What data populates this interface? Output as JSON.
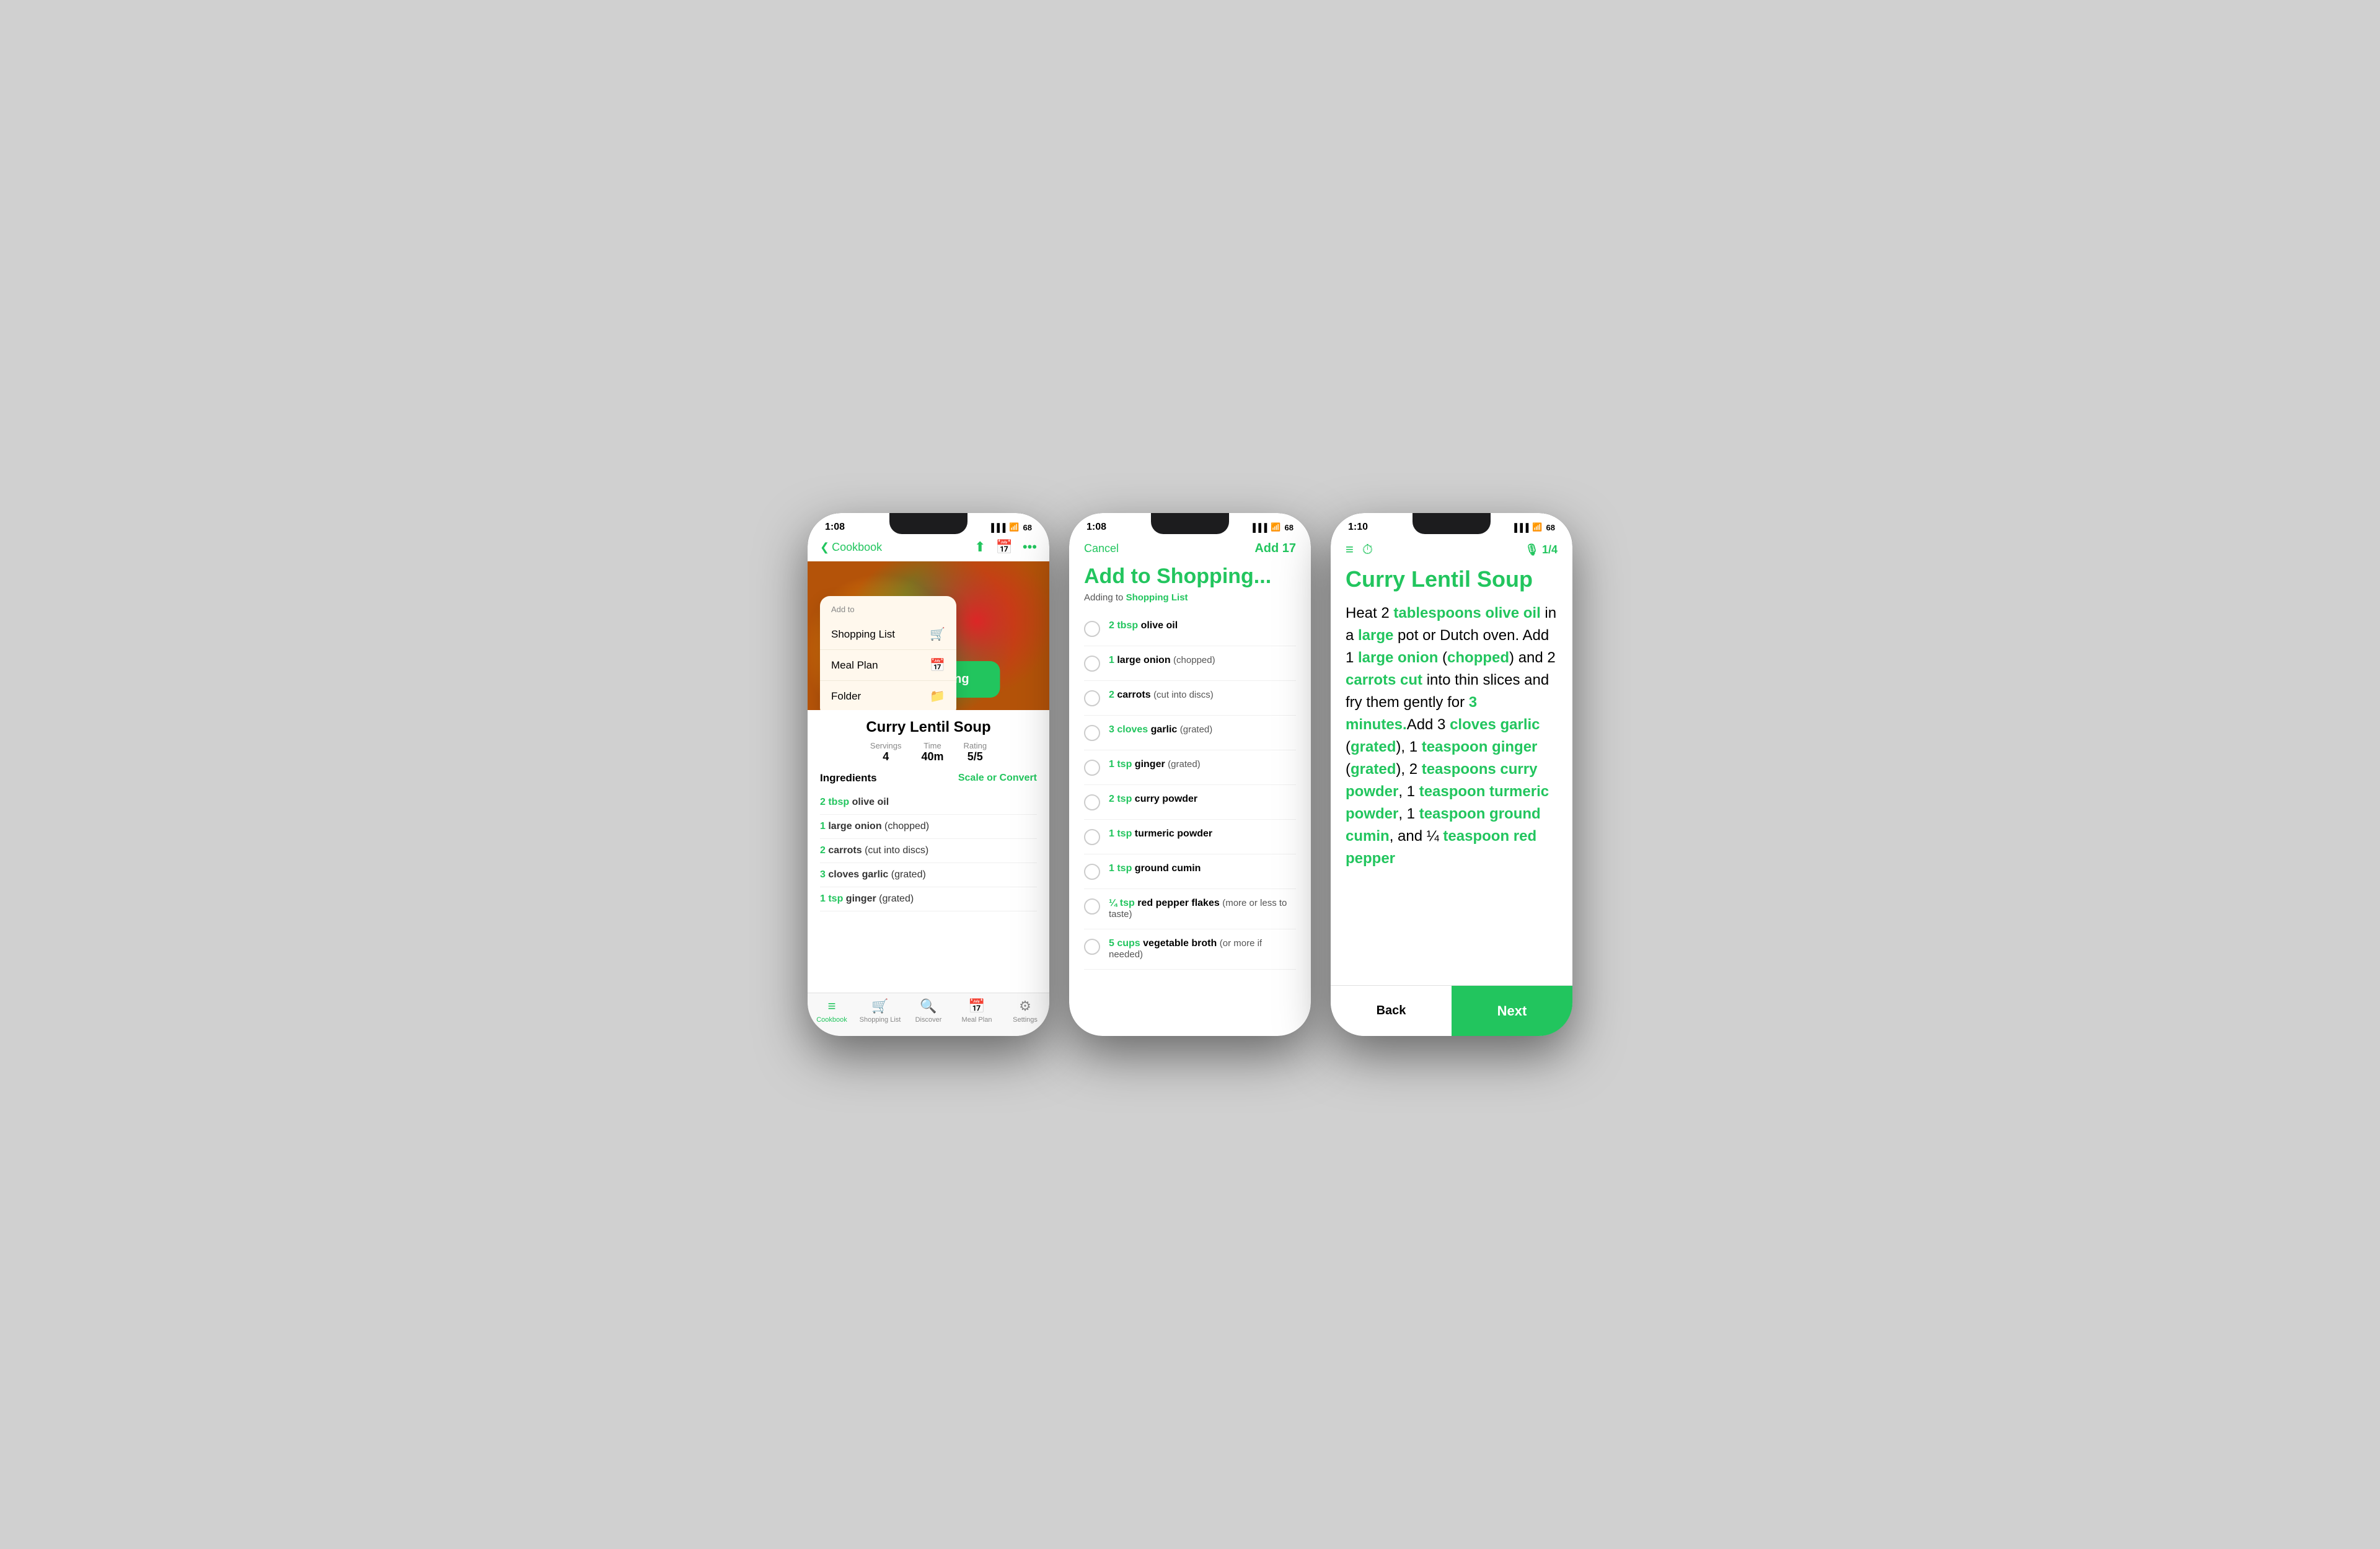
{
  "colors": {
    "green": "#22c55e",
    "white": "#ffffff",
    "black": "#000000",
    "gray": "#888888",
    "light_gray": "#f0f0f0",
    "dropdown_bg": "#fff8ed"
  },
  "phone1": {
    "status_time": "1:08",
    "nav_back_label": "Cookbook",
    "dropdown": {
      "label": "Add to",
      "items": [
        {
          "label": "Shopping List",
          "icon": "🛒"
        },
        {
          "label": "Meal Plan",
          "icon": "📅"
        },
        {
          "label": "Folder",
          "icon": "📁"
        }
      ]
    },
    "start_cooking_label": "Start Cooking",
    "recipe_title": "Curry Lentil Soup",
    "servings_label": "Servings",
    "servings_value": "4",
    "time_label": "Time",
    "time_value": "40m",
    "rating_label": "Rating",
    "rating_value": "5/5",
    "ingredients_title": "Ingredients",
    "scale_label": "Scale or Convert",
    "ingredients": [
      {
        "amount": "2 tbsp",
        "name": "olive oil",
        "note": ""
      },
      {
        "amount": "1",
        "name": "large onion",
        "note": "(chopped)"
      },
      {
        "amount": "2",
        "name": "carrots",
        "note": "(cut into discs)"
      },
      {
        "amount": "3 cloves",
        "name": "garlic",
        "note": "(grated)"
      },
      {
        "amount": "1 tsp",
        "name": "ginger",
        "note": "(grated)"
      }
    ],
    "tabs": [
      {
        "label": "Cookbook",
        "icon": "≡",
        "active": true
      },
      {
        "label": "Shopping List",
        "icon": "🛒",
        "active": false
      },
      {
        "label": "Discover",
        "icon": "🔍",
        "active": false
      },
      {
        "label": "Meal Plan",
        "icon": "📅",
        "active": false
      },
      {
        "label": "Settings",
        "icon": "⚙",
        "active": false
      }
    ]
  },
  "phone2": {
    "status_time": "1:08",
    "cancel_label": "Cancel",
    "add_label": "Add 17",
    "title": "Add to Shopping...",
    "subtitle": "Adding to",
    "subtitle_list": "Shopping List",
    "items": [
      {
        "amount": "2 tbsp",
        "name": "olive oil",
        "note": ""
      },
      {
        "amount": "1",
        "name": "large onion",
        "note": "(chopped)"
      },
      {
        "amount": "2",
        "name": "carrots",
        "note": "(cut into discs)"
      },
      {
        "amount": "3 cloves",
        "name": "garlic",
        "note": "(grated)"
      },
      {
        "amount": "1 tsp",
        "name": "ginger",
        "note": "(grated)"
      },
      {
        "amount": "2 tsp",
        "name": "curry powder",
        "note": ""
      },
      {
        "amount": "1 tsp",
        "name": "turmeric powder",
        "note": ""
      },
      {
        "amount": "1 tsp",
        "name": "ground cumin",
        "note": ""
      },
      {
        "amount": "¼ tsp",
        "name": "red pepper flakes",
        "note": "(more or less to taste)"
      },
      {
        "amount": "5 cups",
        "name": "vegetable broth",
        "note": "(or more if needed)"
      }
    ]
  },
  "phone3": {
    "status_time": "1:10",
    "step_indicator": "1/4",
    "recipe_title": "Curry Lentil Soup",
    "cook_text_parts": [
      {
        "text": "Heat 2 ",
        "highlight": false
      },
      {
        "text": "tablespoons olive oil",
        "highlight": true
      },
      {
        "text": " in a ",
        "highlight": false
      },
      {
        "text": "large",
        "highlight": true
      },
      {
        "text": " pot or Dutch oven. Add 1 ",
        "highlight": false
      },
      {
        "text": "large onion",
        "highlight": true
      },
      {
        "text": " (",
        "highlight": false
      },
      {
        "text": "chopped",
        "highlight": true
      },
      {
        "text": ") and 2 ",
        "highlight": false
      },
      {
        "text": "carrots cut",
        "highlight": true
      },
      {
        "text": " into thin slices and fry them gently for ",
        "highlight": false
      },
      {
        "text": "3 minutes.",
        "highlight": true
      },
      {
        "text": "Add 3 ",
        "highlight": false
      },
      {
        "text": "cloves garlic",
        "highlight": true
      },
      {
        "text": " (",
        "highlight": false
      },
      {
        "text": "grated",
        "highlight": true
      },
      {
        "text": "), 1 ",
        "highlight": false
      },
      {
        "text": "teaspoon ginger",
        "highlight": true
      },
      {
        "text": " (",
        "highlight": false
      },
      {
        "text": "grated",
        "highlight": true
      },
      {
        "text": "), 2 ",
        "highlight": false
      },
      {
        "text": "teaspoons curry powder",
        "highlight": true
      },
      {
        "text": ", 1 ",
        "highlight": false
      },
      {
        "text": "teaspoon turmeric powder",
        "highlight": true
      },
      {
        "text": ", 1 ",
        "highlight": false
      },
      {
        "text": "teaspoon ground cumin",
        "highlight": true
      },
      {
        "text": ", and ¼ ",
        "highlight": false
      },
      {
        "text": "teaspoon red pepper",
        "highlight": true
      }
    ],
    "back_label": "Back",
    "next_label": "Next"
  }
}
